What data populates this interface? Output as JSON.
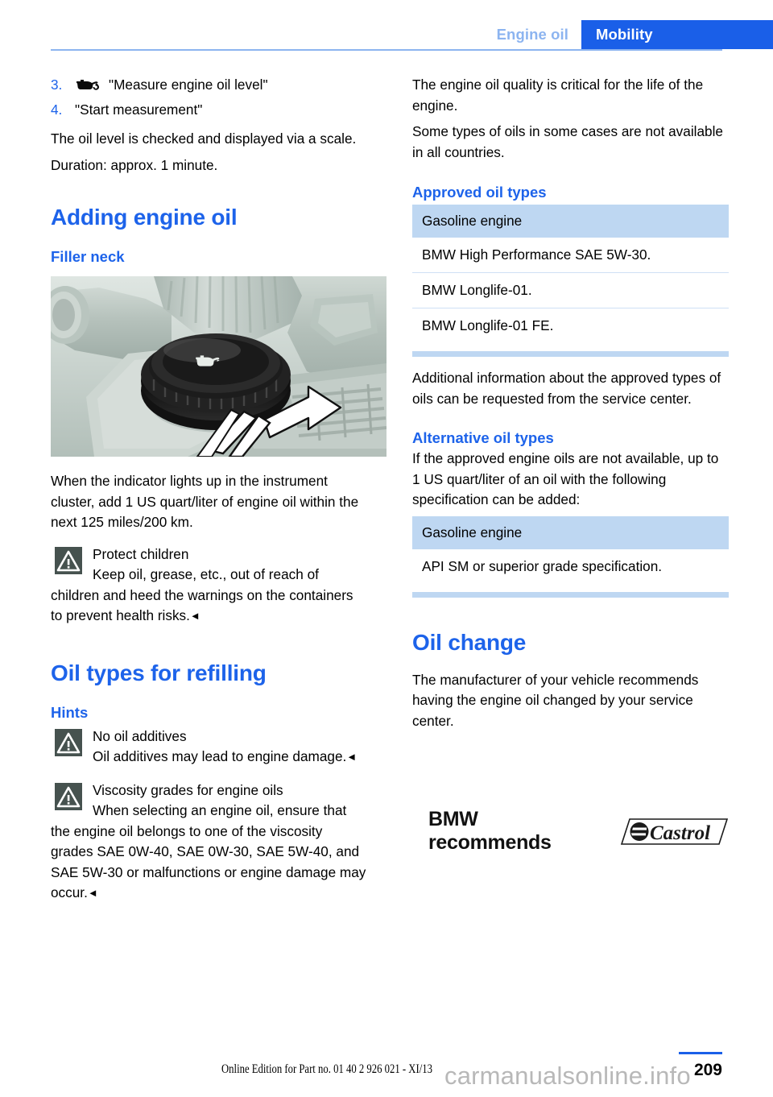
{
  "header": {
    "chapter": "Engine oil",
    "section": "Mobility"
  },
  "left_column": {
    "steps": [
      {
        "number": "3.",
        "icon": "oil-can-icon",
        "label": "\"Measure engine oil level\""
      },
      {
        "number": "4.",
        "icon": "",
        "label": "\"Start measurement\""
      }
    ],
    "after_steps": [
      "The oil level is checked and displayed via a scale.",
      "Duration: approx. 1 minute."
    ],
    "heading_adding": "Adding engine oil",
    "subheading_filler": "Filler neck",
    "figure_caption_alt": "Engine compartment showing black oil filler cap with oil-can symbol and white turn arrow",
    "after_figure": "When the indicator lights up in the instrument cluster, add 1 US quart/liter of engine oil within the next 125 miles/200 km.",
    "warning_protect_children": {
      "icon": "warning-triangle-icon",
      "title": "Protect children",
      "body": "Keep oil, grease, etc., out of reach of children and heed the warnings on the containers to prevent health risks."
    },
    "heading_oil_types": "Oil types for refilling",
    "subheading_hints": "Hints",
    "hint_additives": {
      "icon": "warning-triangle-icon",
      "title": "No oil additives",
      "body": "Oil additives may lead to engine damage."
    },
    "hint_viscosity": {
      "icon": "warning-triangle-icon",
      "title": "Viscosity grades for engine oils",
      "body": "When selecting an engine oil, ensure that the engine oil belongs to one of the viscosity grades SAE 0W-40, SAE 0W-30, SAE 5W-40, and SAE 5W-30 or malfunctions or engine damage may occur."
    },
    "endmark": "◄"
  },
  "right_column": {
    "intro": [
      "The engine oil quality is critical for the life of the engine.",
      "Some types of oils in some cases are not available in all countries."
    ],
    "heading_approved": "Approved oil types",
    "approved_table": {
      "header": "Gasoline engine",
      "rows": [
        "BMW High Performance SAE 5W-30.",
        "BMW Longlife-01.",
        "BMW Longlife-01 FE."
      ]
    },
    "after_approved": "Additional information about the approved types of oils can be requested from the service center.",
    "heading_alternative": "Alternative oil types",
    "alternative_intro": "If the approved engine oils are not available, up to 1 US quart/liter of an oil with the following specification can be added:",
    "alternative_table": {
      "header": "Gasoline engine",
      "rows": [
        "API SM or superior grade specification."
      ]
    },
    "heading_oil_change": "Oil change",
    "oil_change_body": "The manufacturer of your vehicle recommends having the engine oil changed by your service center.",
    "recommends_text": "BMW recommends",
    "castrol_wordmark": "Castrol"
  },
  "footer": {
    "edition": "Online Edition for Part no. 01 40 2 926 021 - XI/13",
    "page_number": "209",
    "watermark": "carmanualsonline.info"
  },
  "colors": {
    "accent_blue": "#1d63ea",
    "tab_blue": "#1a5fe8",
    "light_blue": "#8cb4f0",
    "table_header_blue": "#bed7f2",
    "table_divider_blue": "#cfe0f5",
    "warning_icon_bg": "#46524f",
    "watermark_gray": "#b8b8b8"
  }
}
